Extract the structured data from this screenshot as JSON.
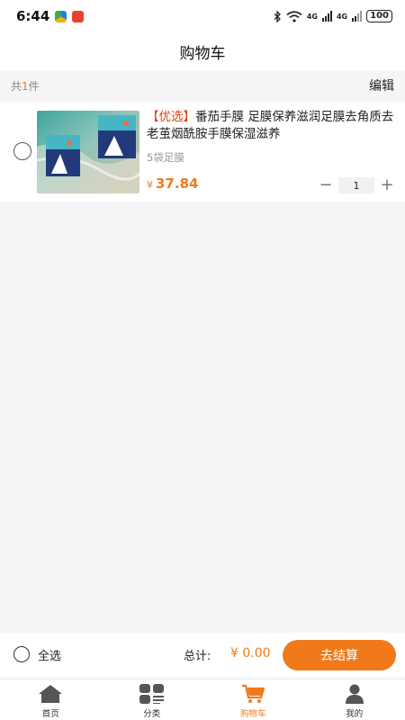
{
  "status_bar": {
    "time": "6:44",
    "network_1": "4G",
    "network_2": "4G",
    "battery": "100"
  },
  "header": {
    "title": "购物车"
  },
  "count_bar": {
    "prefix": "共",
    "count": "1",
    "suffix": "件",
    "edit_label": "编辑"
  },
  "cart": {
    "items": [
      {
        "tag": "【优选】",
        "title": "番茄手膜 足膜保养滋润足膜去角质去老茧烟酰胺手膜保湿滋养",
        "spec": "5袋足膜",
        "currency": "¥",
        "price": "37.84",
        "quantity": "1",
        "minus": "−",
        "plus": "+"
      }
    ]
  },
  "checkout": {
    "select_all_label": "全选",
    "total_label": "总计:",
    "total_amount": "¥ 0.00",
    "checkout_label": "去结算"
  },
  "tabs": [
    {
      "label": "首页",
      "icon": "home-icon",
      "active": false
    },
    {
      "label": "分类",
      "icon": "category-icon",
      "active": false
    },
    {
      "label": "购物车",
      "icon": "cart-icon",
      "active": true
    },
    {
      "label": "我的",
      "icon": "user-icon",
      "active": false
    }
  ],
  "colors": {
    "accent": "#f07a1a",
    "tag_red": "#e0431b"
  }
}
